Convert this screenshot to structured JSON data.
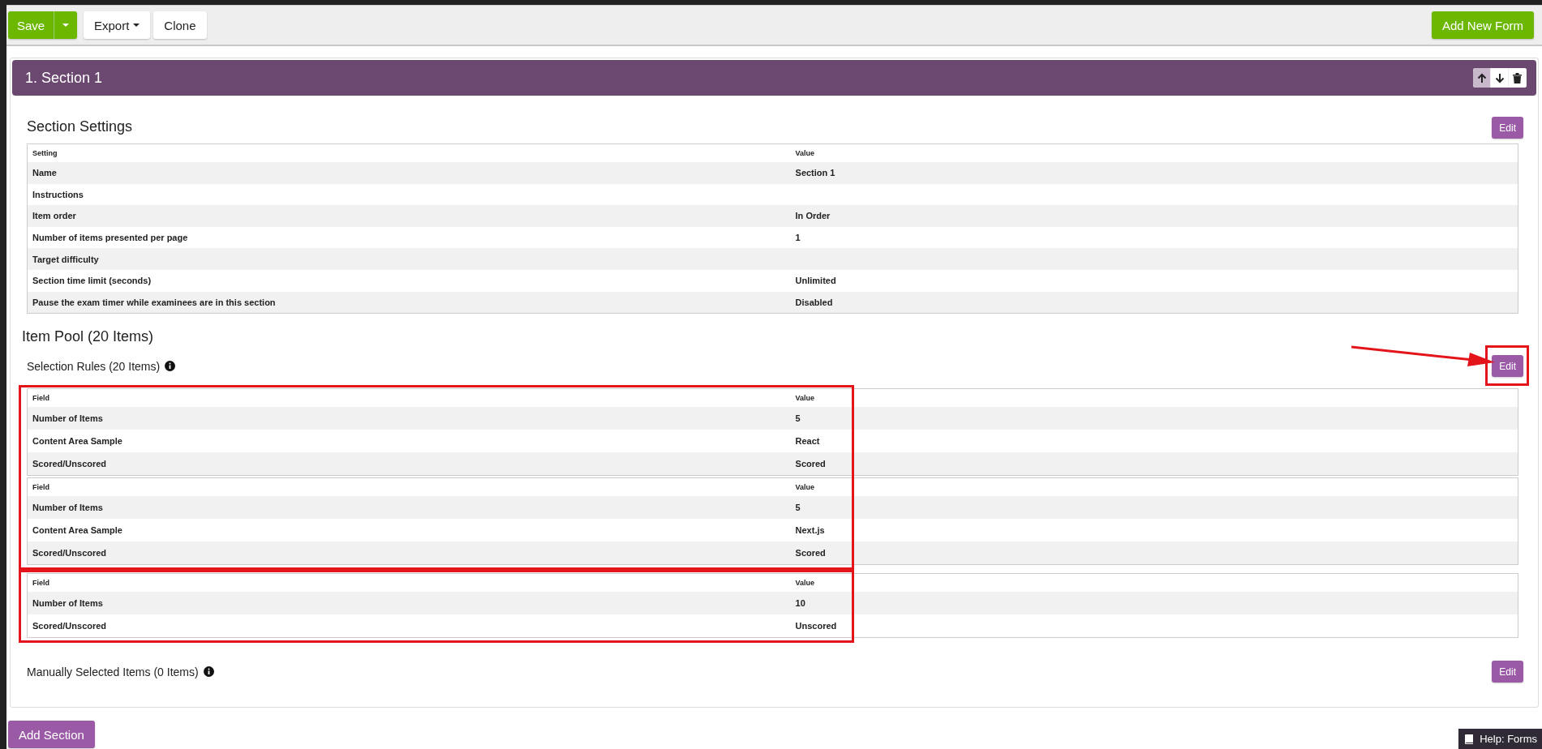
{
  "toolbar": {
    "save": "Save",
    "export": "Export",
    "clone": "Clone",
    "add_form": "Add New Form"
  },
  "section": {
    "title": "1. Section 1",
    "settings": {
      "title": "Section Settings",
      "edit": "Edit",
      "columns": [
        "Setting",
        "Value"
      ],
      "rows": [
        [
          "Name",
          "Section 1"
        ],
        [
          "Instructions",
          ""
        ],
        [
          "Item order",
          "In Order"
        ],
        [
          "Number of items presented per page",
          "1"
        ],
        [
          "Target difficulty",
          ""
        ],
        [
          "Section time limit (seconds)",
          "Unlimited"
        ],
        [
          "Pause the exam timer while examinees are in this section",
          "Disabled"
        ]
      ]
    },
    "item_pool": {
      "title": "Item Pool (20 Items)",
      "selection_rules": {
        "title": "Selection Rules (20 Items)",
        "edit": "Edit",
        "edit_highlighted": true,
        "groups": [
          {
            "highlighted": true,
            "rules": [
              {
                "columns": [
                  "Field",
                  "Value"
                ],
                "rows": [
                  [
                    "Number of Items",
                    "5"
                  ],
                  [
                    "Content Area Sample",
                    "React"
                  ],
                  [
                    "Scored/Unscored",
                    "Scored"
                  ]
                ]
              },
              {
                "columns": [
                  "Field",
                  "Value"
                ],
                "rows": [
                  [
                    "Number of Items",
                    "5"
                  ],
                  [
                    "Content Area Sample",
                    "Next.js"
                  ],
                  [
                    "Scored/Unscored",
                    "Scored"
                  ]
                ]
              }
            ]
          },
          {
            "highlighted": true,
            "rules": [
              {
                "columns": [
                  "Field",
                  "Value"
                ],
                "rows": [
                  [
                    "Number of Items",
                    "10"
                  ],
                  [
                    "Scored/Unscored",
                    "Unscored"
                  ]
                ]
              }
            ]
          }
        ]
      },
      "manual": {
        "title": "Manually Selected Items (0 Items)",
        "edit": "Edit"
      }
    }
  },
  "add_section": "Add Section",
  "help": "Help: Forms"
}
